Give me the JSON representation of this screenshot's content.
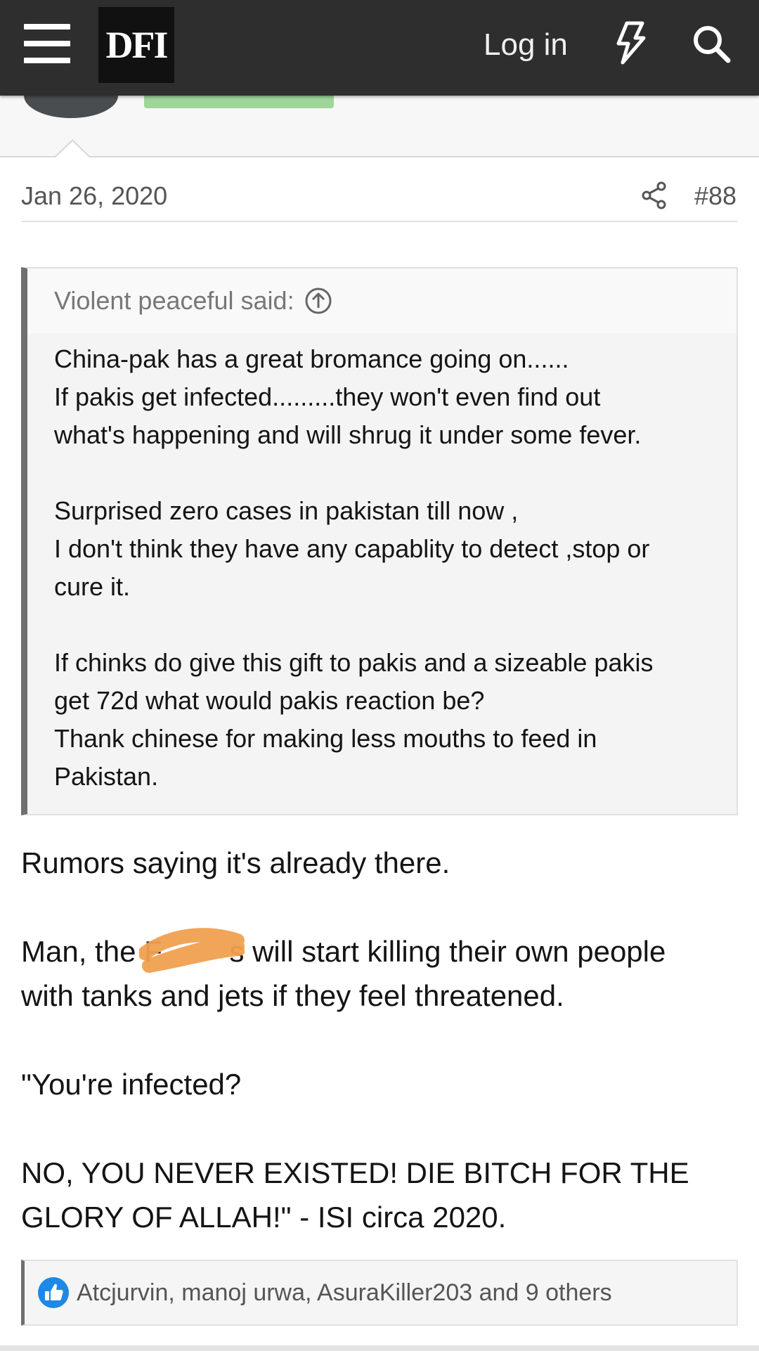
{
  "header": {
    "logo_text": "DFI",
    "login_label": "Log in",
    "icons": [
      "menu-icon",
      "bolt-icon",
      "search-icon"
    ]
  },
  "post": {
    "date": "Jan 26, 2020",
    "number": "#88",
    "quote": {
      "author_line": "Violent peaceful said:",
      "lines": [
        "China-pak has a great bromance going on......",
        "If pakis get infected.........they won't even find out",
        "what's happening and will shrug it under some fever.",
        "",
        "Surprised zero cases in pakistan till now ,",
        "I don't think they have any capablity to detect ,stop or",
        "cure it.",
        "",
        "If chinks do give this gift to pakis and a sizeable pakis",
        "get 72d what would pakis reaction be?",
        "Thank chinese for making less mouths to feed in",
        "Pakistan."
      ]
    },
    "message": {
      "lines": [
        "Rumors saying it's already there.",
        "",
        "Man, the F   s will start killing their own people",
        "with tanks and jets if they feel threatened.",
        "",
        "\"You're infected?",
        "",
        "NO, YOU NEVER EXISTED! DIE BITCH FOR THE",
        "GLORY OF ALLAH!\" - ISI circa 2020."
      ]
    },
    "reactions": {
      "text": "Atcjurvin, manoj urwa, AsuraKiller203 and 9 others",
      "icon": "like-icon"
    }
  },
  "colors": {
    "header_bg": "#2e2e2e",
    "quote_bar": "#6f6f6f",
    "like_blue": "#1e88e5",
    "scribble": "#f0a050"
  }
}
